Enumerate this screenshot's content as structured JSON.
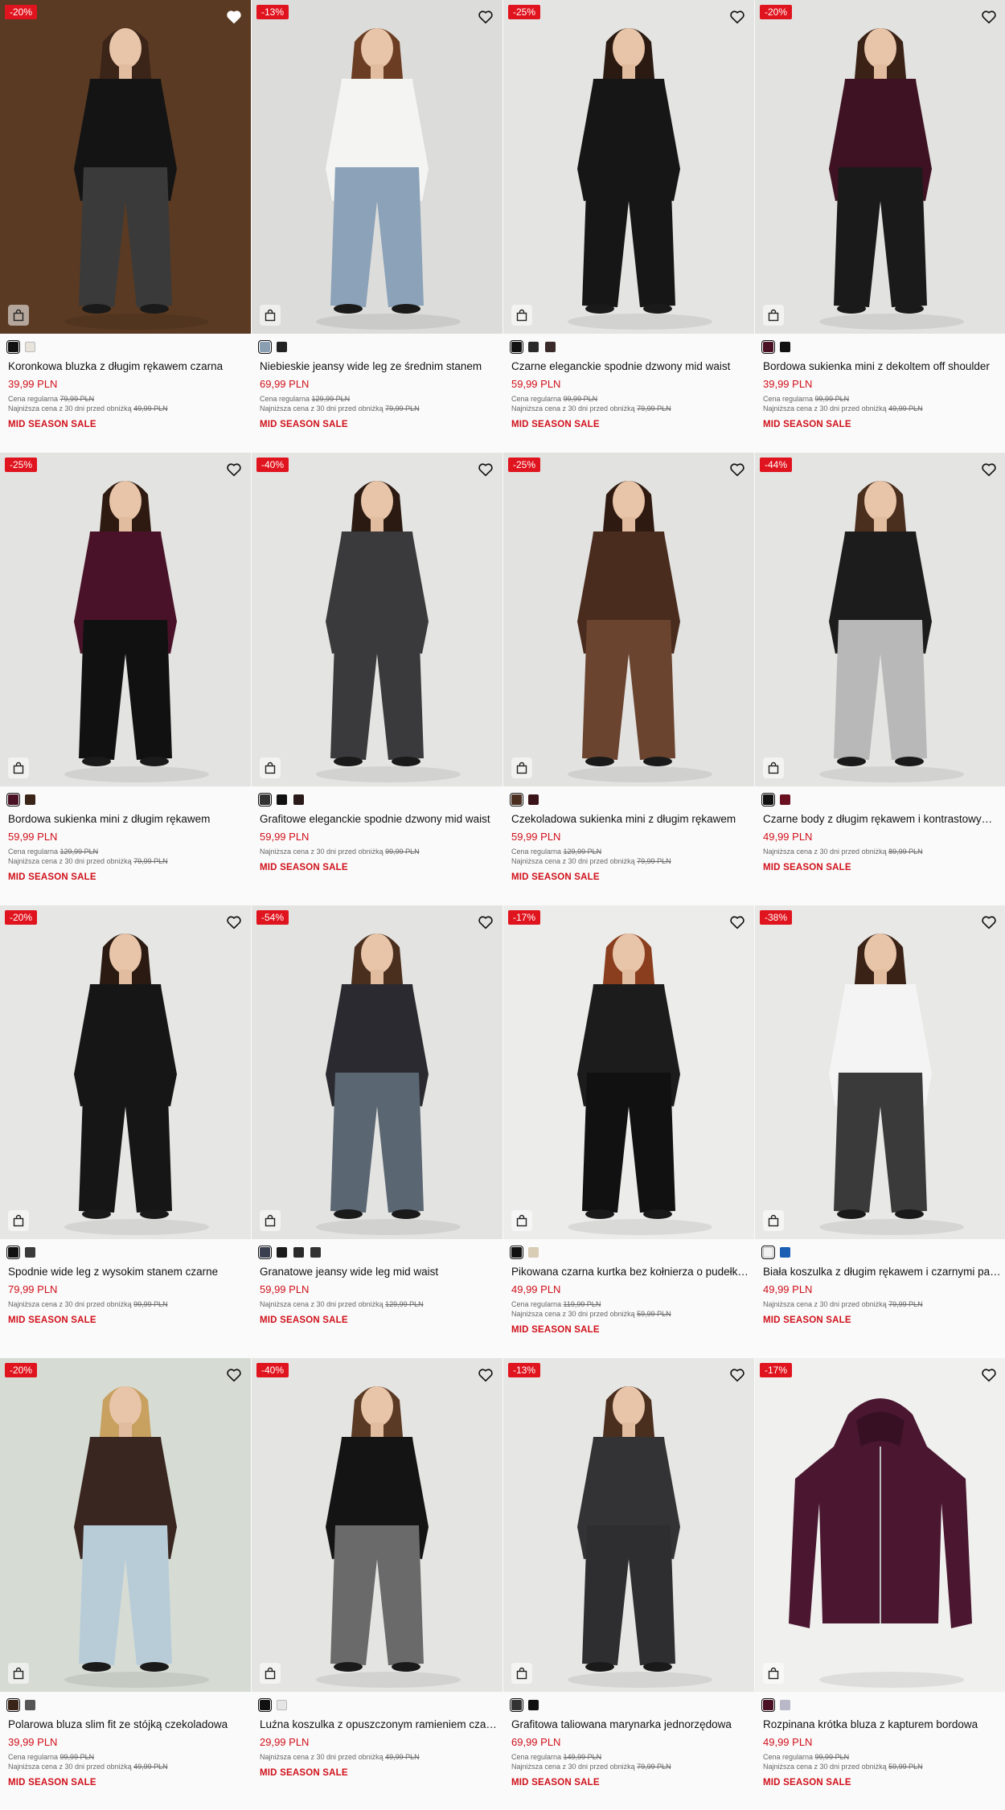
{
  "labels": {
    "regular_price": "Cena regularna",
    "lowest_price": "Najniższa cena z 30 dni przed obniżką",
    "wishlist_icon": "heart-icon",
    "bag_icon": "shopping-bag-icon"
  },
  "products": [
    {
      "name": "Koronkowa bluzka z długim rękawem czarna",
      "discount": "-20%",
      "price": "39,99 PLN",
      "regular": "79,99 PLN",
      "lowest": "49,99 PLN",
      "sale": "MID SEASON SALE",
      "swatches": [
        "#111111",
        "#e8e4dc"
      ],
      "bg": "#5a3a22",
      "outfit": "#141414",
      "pants": "#3a3a3a",
      "hair": "#3b2418"
    },
    {
      "name": "Niebieskie jeansy wide leg ze średnim stanem",
      "discount": "-13%",
      "price": "69,99 PLN",
      "regular": "129,99 PLN",
      "lowest": "79,99 PLN",
      "sale": "MID SEASON SALE",
      "swatches": [
        "#8a9fb2",
        "#222222"
      ],
      "bg": "#dcdcda",
      "outfit": "#f4f4f2",
      "pants": "#8ba2b8",
      "hair": "#6b3d22"
    },
    {
      "name": "Czarne eleganckie spodnie dzwony mid waist",
      "discount": "-25%",
      "price": "59,99 PLN",
      "regular": "99,99 PLN",
      "lowest": "79,99 PLN",
      "sale": "MID SEASON SALE",
      "swatches": [
        "#111111",
        "#2b2b2b",
        "#3a2a2a"
      ],
      "bg": "#e4e4e2",
      "outfit": "#161616",
      "pants": "#161616",
      "hair": "#2a1a12"
    },
    {
      "name": "Bordowa sukienka mini z dekoltem off shoulder",
      "discount": "-20%",
      "price": "39,99 PLN",
      "regular": "99,99 PLN",
      "lowest": "49,99 PLN",
      "sale": "MID SEASON SALE",
      "swatches": [
        "#4a1024",
        "#111111"
      ],
      "bg": "#e2e2e0",
      "outfit": "#3e1222",
      "pants": "#1a1a1a",
      "hair": "#3a2216"
    },
    {
      "name": "Bordowa sukienka mini z długim rękawem",
      "discount": "-25%",
      "price": "59,99 PLN",
      "regular": "129,99 PLN",
      "lowest": "79,99 PLN",
      "sale": "MID SEASON SALE",
      "swatches": [
        "#4a1024",
        "#3a2418"
      ],
      "bg": "#e3e3e1",
      "outfit": "#4a1228",
      "pants": "#111111",
      "hair": "#2e1a10"
    },
    {
      "name": "Grafitowe eleganckie spodnie dzwony mid waist",
      "discount": "-40%",
      "price": "59,99 PLN",
      "regular": "",
      "lowest": "99,99 PLN",
      "sale": "MID SEASON SALE",
      "swatches": [
        "#333333",
        "#111111",
        "#2a1a1a"
      ],
      "bg": "#e4e4e2",
      "outfit": "#3a3a3c",
      "pants": "#3a3a3c",
      "hair": "#2a1a12"
    },
    {
      "name": "Czekoladowa sukienka mini z długim rękawem",
      "discount": "-25%",
      "price": "59,99 PLN",
      "regular": "129,99 PLN",
      "lowest": "79,99 PLN",
      "sale": "MID SEASON SALE",
      "swatches": [
        "#4a2e20",
        "#3a1418"
      ],
      "bg": "#e2e2e0",
      "outfit": "#4a2c1e",
      "pants": "#6b4430",
      "hair": "#2e1a10"
    },
    {
      "name": "Czarne body z długim rękawem i kontrastowymi liniami",
      "discount": "-44%",
      "price": "49,99 PLN",
      "regular": "",
      "lowest": "89,99 PLN",
      "sale": "MID SEASON SALE",
      "swatches": [
        "#111111",
        "#6a1020"
      ],
      "bg": "#e4e4e2",
      "outfit": "#1c1c1c",
      "pants": "#b8b8b8",
      "hair": "#4a2e1e"
    },
    {
      "name": "Spodnie wide leg z wysokim stanem czarne",
      "discount": "-20%",
      "price": "79,99 PLN",
      "regular": "",
      "lowest": "99,99 PLN",
      "sale": "MID SEASON SALE",
      "swatches": [
        "#111111",
        "#3a3a3a"
      ],
      "bg": "#e6e6e4",
      "outfit": "#161616",
      "pants": "#161616",
      "hair": "#2a1a12"
    },
    {
      "name": "Granatowe jeansy wide leg mid waist",
      "discount": "-54%",
      "price": "59,99 PLN",
      "regular": "",
      "lowest": "129,99 PLN",
      "sale": "MID SEASON SALE",
      "swatches": [
        "#3a4050",
        "#1a1a1a",
        "#2a2a2a",
        "#333333"
      ],
      "bg": "#e3e3e1",
      "outfit": "#2a2a30",
      "pants": "#5a6672",
      "hair": "#4a2e1e"
    },
    {
      "name": "Pikowana czarna kurtka bez kołnierza o pudełkowym kroju",
      "discount": "-17%",
      "price": "49,99 PLN",
      "regular": "119,99 PLN",
      "lowest": "59,99 PLN",
      "sale": "MID SEASON SALE",
      "swatches": [
        "#111111",
        "#d8ccb4"
      ],
      "bg": "#ececea",
      "outfit": "#1c1c1c",
      "pants": "#111111",
      "hair": "#8a3e1e"
    },
    {
      "name": "Biała koszulka z długim rękawem i czarnymi paskami",
      "discount": "-38%",
      "price": "49,99 PLN",
      "regular": "",
      "lowest": "79,99 PLN",
      "sale": "MID SEASON SALE",
      "swatches": [
        "#f2f2f2",
        "#1a5fb4"
      ],
      "bg": "#e8e8e6",
      "outfit": "#f4f4f4",
      "pants": "#3a3a3a",
      "hair": "#3a2216"
    },
    {
      "name": "Polarowa bluza slim fit ze stójką czekoladowa",
      "discount": "-20%",
      "price": "39,99 PLN",
      "regular": "99,99 PLN",
      "lowest": "49,99 PLN",
      "sale": "MID SEASON SALE",
      "swatches": [
        "#3a2418",
        "#555555"
      ],
      "bg": "#d6dcd4",
      "outfit": "#3a2620",
      "pants": "#b8ccd8",
      "hair": "#c8a060"
    },
    {
      "name": "Luźna koszulka z opuszczonym ramieniem czarna",
      "discount": "-40%",
      "price": "29,99 PLN",
      "regular": "",
      "lowest": "49,99 PLN",
      "sale": "MID SEASON SALE",
      "swatches": [
        "#111111",
        "#e6e6e6"
      ],
      "bg": "#e4e4e2",
      "outfit": "#141414",
      "pants": "#6a6a6a",
      "hair": "#5a3a24"
    },
    {
      "name": "Grafitowa taliowana marynarka jednorzędowa",
      "discount": "-13%",
      "price": "69,99 PLN",
      "regular": "149,99 PLN",
      "lowest": "79,99 PLN",
      "sale": "MID SEASON SALE",
      "swatches": [
        "#333333",
        "#111111"
      ],
      "bg": "#e6e6e4",
      "outfit": "#333335",
      "pants": "#2e2e30",
      "hair": "#4a2e1e"
    },
    {
      "name": "Rozpinana krótka bluza z kapturem bordowa",
      "discount": "-17%",
      "price": "49,99 PLN",
      "regular": "99,99 PLN",
      "lowest": "59,99 PLN",
      "sale": "MID SEASON SALE",
      "swatches": [
        "#4a1024",
        "#b8b8c8"
      ],
      "bg": "#f0f0ee",
      "outfit": "#4a1630",
      "pants": "#4a1630",
      "hair": ""
    }
  ]
}
